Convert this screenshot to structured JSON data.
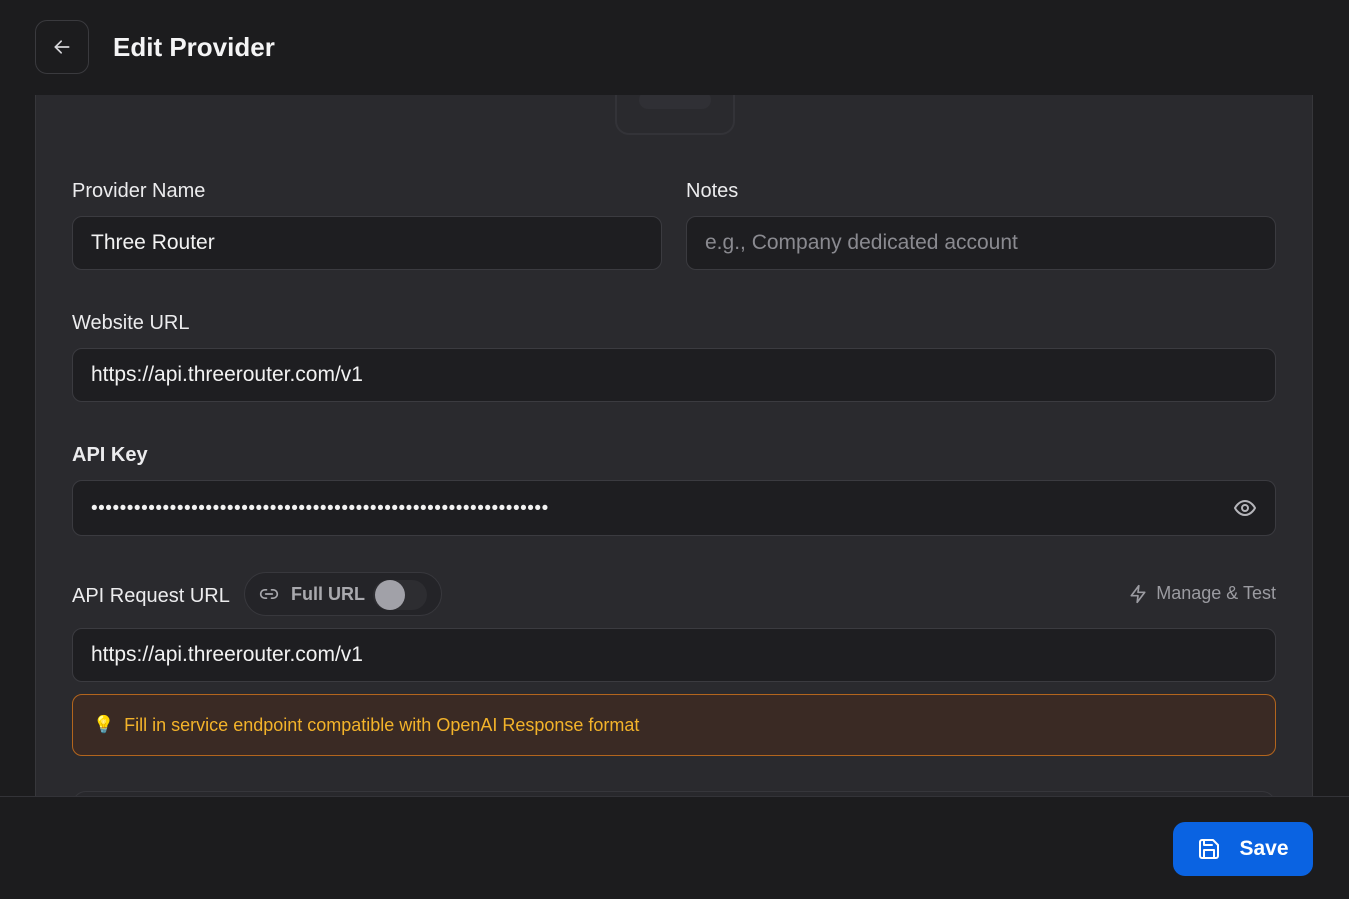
{
  "header": {
    "title": "Edit Provider",
    "back_icon": "arrow-left-icon"
  },
  "form": {
    "provider_name": {
      "label": "Provider Name",
      "value": "Three Router"
    },
    "notes": {
      "label": "Notes",
      "value": "",
      "placeholder": "e.g., Company dedicated account"
    },
    "website_url": {
      "label": "Website URL",
      "value": "https://api.threerouter.com/v1"
    },
    "api_key": {
      "label": "API Key",
      "masked_value": "••••••••••••••••••••••••••••••••••••••••••••••••••••••••••••••••",
      "reveal_icon": "eye-icon"
    },
    "api_request_url": {
      "label": "API Request URL",
      "full_url_toggle": {
        "label": "Full URL",
        "icon": "link-icon",
        "enabled": false
      },
      "manage_test": {
        "label": "Manage & Test",
        "icon": "lightning-icon"
      },
      "value": "https://api.threerouter.com/v1",
      "hint": {
        "icon": "💡",
        "text": "Fill in service endpoint compatible with OpenAI Response format"
      }
    }
  },
  "footer": {
    "save_label": "Save",
    "save_icon": "save-icon"
  },
  "colors": {
    "primary": "#0a63e2",
    "background": "#1c1c1e",
    "card": "#2a2a2e",
    "hint_border": "#b3651d",
    "hint_text": "#f3b32a"
  }
}
